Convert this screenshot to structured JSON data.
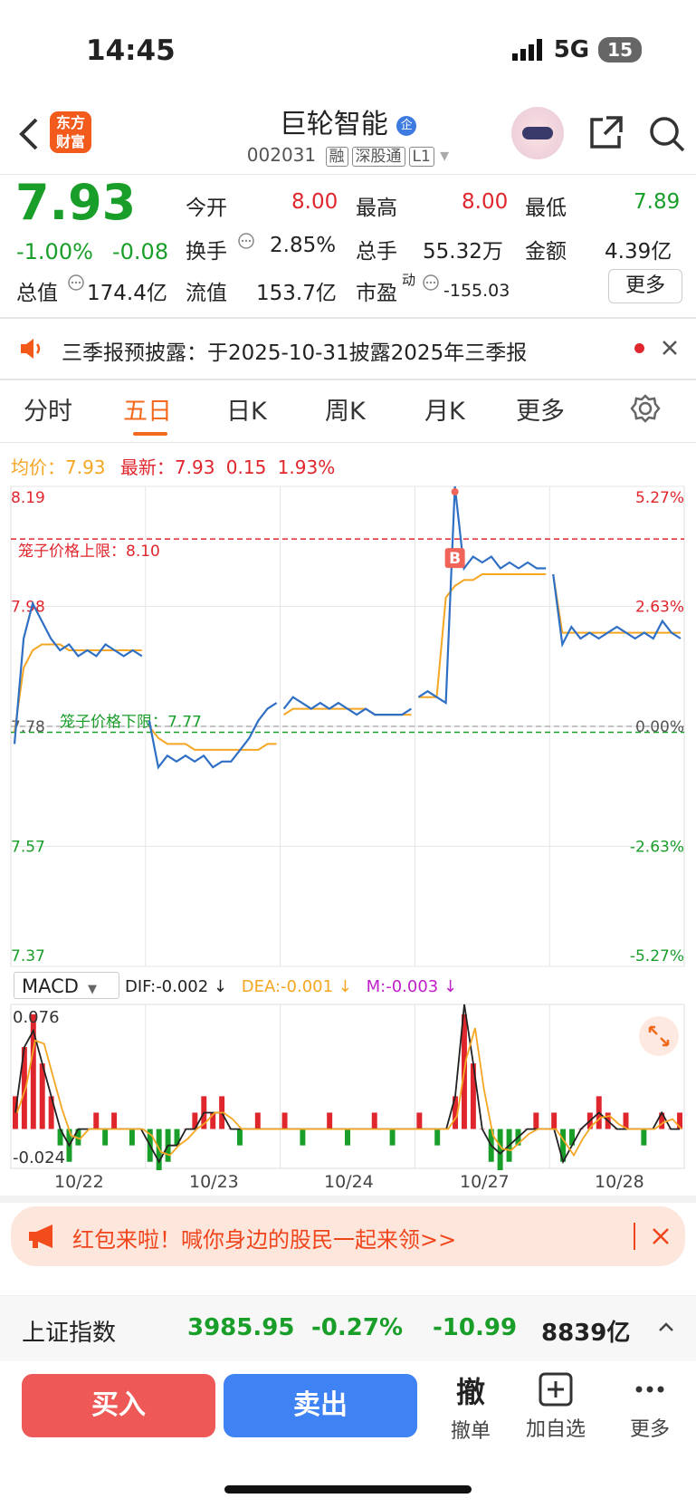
{
  "status": {
    "time": "14:45",
    "network": "5G",
    "battery": "15"
  },
  "header": {
    "title": "巨轮智能",
    "badge": "企",
    "code": "002031",
    "tags": [
      "融",
      "深股通",
      "L1"
    ],
    "logo_text": "东方财富"
  },
  "quote": {
    "price": "7.93",
    "change_pct": "-1.00%",
    "change": "-0.08",
    "open_label": "今开",
    "open": "8.00",
    "high_label": "最高",
    "high": "8.00",
    "low_label": "最低",
    "low": "7.89",
    "turnover_label": "换手",
    "turnover": "2.85%",
    "volume_label": "总手",
    "volume": "55.32万",
    "amount_label": "金额",
    "amount": "4.39亿",
    "mcap_label": "总值",
    "mcap": "174.4亿",
    "float_label": "流值",
    "float": "153.7亿",
    "pe_label": "市盈",
    "pe_sup": "动",
    "pe": "-155.03",
    "more_label": "更多"
  },
  "notice": {
    "text": "三季报预披露：于2025-10-31披露2025年三季报"
  },
  "tabs": [
    "分时",
    "五日",
    "日K",
    "周K",
    "月K",
    "更多"
  ],
  "chart_info": {
    "avg_label": "均价：",
    "avg": "7.93",
    "latest_label": "最新：",
    "latest": "7.93",
    "latest_change": "0.15",
    "latest_pct": "1.93%"
  },
  "chart_data": {
    "type": "line",
    "y_ticks_left": [
      "8.19",
      "7.98",
      "7.78",
      "7.57",
      "7.37"
    ],
    "y_ticks_right": [
      "5.27%",
      "2.63%",
      "0.00%",
      "-2.63%",
      "-5.27%"
    ],
    "ylim": [
      7.37,
      8.19
    ],
    "x_labels": [
      "10/22",
      "10/23",
      "10/24",
      "10/27",
      "10/28"
    ],
    "upper_limit_label": "笼子价格上限：8.10",
    "upper_limit": 8.1,
    "lower_limit_label": "笼子价格下限：7.77",
    "lower_limit": 7.77,
    "marker": "B",
    "series": [
      {
        "name": "price",
        "color": "#2f6fc4"
      },
      {
        "name": "avg",
        "color": "#f5a623"
      }
    ],
    "days": [
      {
        "price": [
          7.75,
          7.93,
          7.99,
          7.96,
          7.93,
          7.91,
          7.92,
          7.9,
          7.91,
          7.9,
          7.92,
          7.91,
          7.9,
          7.91,
          7.9
        ],
        "avg": [
          7.77,
          7.88,
          7.91,
          7.92,
          7.92,
          7.92,
          7.91,
          7.91,
          7.91,
          7.91,
          7.91,
          7.91,
          7.91,
          7.91,
          7.91
        ]
      },
      {
        "price": [
          7.79,
          7.71,
          7.73,
          7.72,
          7.73,
          7.72,
          7.73,
          7.71,
          7.72,
          7.72,
          7.74,
          7.76,
          7.79,
          7.81,
          7.82
        ],
        "avg": [
          7.78,
          7.76,
          7.75,
          7.75,
          7.75,
          7.74,
          7.74,
          7.74,
          7.74,
          7.74,
          7.74,
          7.74,
          7.74,
          7.75,
          7.75
        ]
      },
      {
        "price": [
          7.81,
          7.83,
          7.82,
          7.81,
          7.82,
          7.81,
          7.82,
          7.81,
          7.8,
          7.81,
          7.8,
          7.8,
          7.8,
          7.8,
          7.81
        ],
        "avg": [
          7.8,
          7.81,
          7.81,
          7.81,
          7.81,
          7.81,
          7.81,
          7.81,
          7.81,
          7.81,
          7.8,
          7.8,
          7.8,
          7.8,
          7.8
        ]
      },
      {
        "price": [
          7.83,
          7.84,
          7.83,
          7.82,
          8.19,
          8.05,
          8.07,
          8.06,
          8.07,
          8.05,
          8.06,
          8.05,
          8.06,
          8.05,
          8.05
        ],
        "avg": [
          7.83,
          7.83,
          7.83,
          8.0,
          8.02,
          8.03,
          8.03,
          8.04,
          8.04,
          8.04,
          8.04,
          8.04,
          8.04,
          8.04,
          8.04
        ]
      },
      {
        "price": [
          8.04,
          7.92,
          7.95,
          7.93,
          7.94,
          7.93,
          7.94,
          7.95,
          7.94,
          7.93,
          7.94,
          7.93,
          7.96,
          7.94,
          7.93
        ],
        "avg": [
          8.04,
          7.94,
          7.94,
          7.94,
          7.94,
          7.94,
          7.94,
          7.94,
          7.94,
          7.94,
          7.94,
          7.94,
          7.94,
          7.94,
          7.94
        ]
      }
    ]
  },
  "macd": {
    "label": "MACD",
    "dif": "DIF:-0.002 ↓",
    "dea": "DEA:-0.001 ↓",
    "m": "M:-0.003 ↓",
    "y_top": "0.076",
    "y_bottom": "-0.024",
    "histogram": [
      0.02,
      0.05,
      0.07,
      0.04,
      0.02,
      -0.01,
      -0.02,
      -0.01,
      0.0,
      0.01,
      -0.01,
      0.01,
      0.0,
      -0.01,
      0.0,
      -0.02,
      -0.03,
      -0.02,
      -0.01,
      0.0,
      0.01,
      0.02,
      0.01,
      0.02,
      0.0,
      -0.01,
      0.0,
      0.01,
      0.0,
      0.0,
      0.01,
      0.0,
      -0.01,
      0.0,
      0.0,
      0.01,
      0.0,
      -0.01,
      0.0,
      0.0,
      0.01,
      0.0,
      -0.01,
      0.0,
      0.0,
      0.01,
      0.0,
      -0.01,
      0.0,
      0.02,
      0.07,
      0.04,
      0.0,
      -0.02,
      -0.03,
      -0.02,
      -0.01,
      0.0,
      0.01,
      0.0,
      0.01,
      -0.02,
      -0.01,
      0.0,
      0.01,
      0.02,
      0.01,
      0.0,
      0.01,
      0.0,
      -0.01,
      0.0,
      0.01,
      0.0,
      0.01
    ],
    "dif_line": [
      0.01,
      0.05,
      0.06,
      0.04,
      0.02,
      0.0,
      -0.01,
      0.0,
      0.0,
      0.0,
      0.0,
      0.0,
      0.0,
      0.0,
      0.0,
      -0.01,
      -0.02,
      -0.01,
      -0.01,
      0.0,
      0.0,
      0.01,
      0.01,
      0.01,
      0.0,
      0.0,
      0.0,
      0.0,
      0.0,
      0.0,
      0.0,
      0.0,
      0.0,
      0.0,
      0.0,
      0.0,
      0.0,
      0.0,
      0.0,
      0.0,
      0.0,
      0.0,
      0.0,
      0.0,
      0.0,
      0.0,
      0.0,
      0.0,
      0.0,
      0.02,
      0.076,
      0.04,
      0.0,
      -0.01,
      -0.015,
      -0.01,
      -0.005,
      0.0,
      0.0,
      0.0,
      0.0,
      -0.02,
      -0.01,
      0.0,
      0.005,
      0.01,
      0.005,
      0.0,
      0.0,
      0.0,
      0.0,
      0.0,
      0.01,
      0.0,
      0.0
    ]
  },
  "promo": {
    "text": "红包来啦！喊你身边的股民一起来领>>"
  },
  "index_bar": {
    "name": "上证指数",
    "value": "3985.95",
    "pct": "-0.27%",
    "change": "-10.99",
    "amount": "8839亿"
  },
  "bottom": {
    "buy": "买入",
    "sell": "卖出",
    "cancel_glyph": "撤",
    "cancel": "撤单",
    "add": "加自选",
    "more": "更多"
  }
}
